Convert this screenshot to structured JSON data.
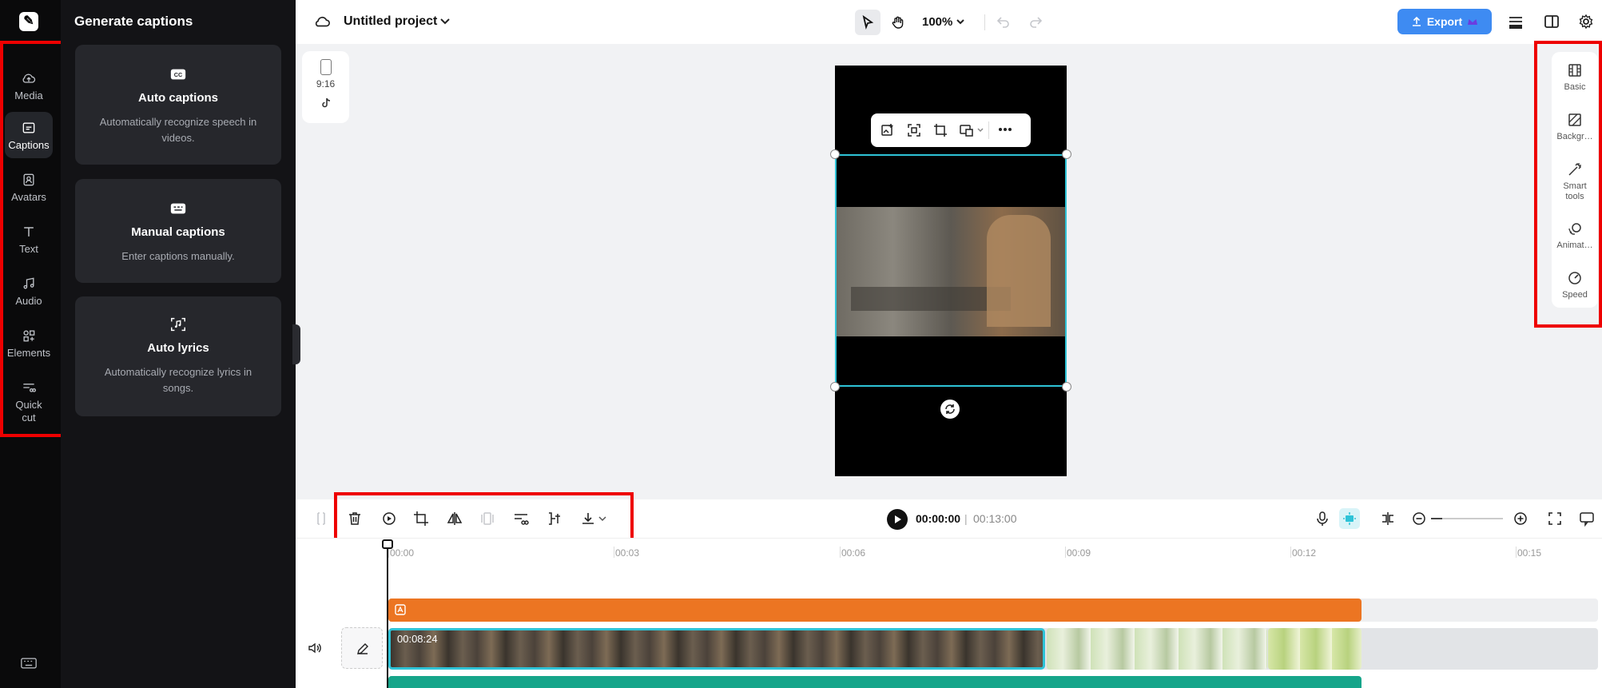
{
  "rail": {
    "items": [
      {
        "label": "Media",
        "icon": "cloud-upload-icon"
      },
      {
        "label": "Captions",
        "icon": "captions-icon"
      },
      {
        "label": "Avatars",
        "icon": "avatar-icon"
      },
      {
        "label": "Text",
        "icon": "text-icon"
      },
      {
        "label": "Audio",
        "icon": "music-note-icon"
      },
      {
        "label": "Elements",
        "icon": "elements-icon"
      },
      {
        "label": "Quick cut",
        "icon": "scissors-icon"
      }
    ],
    "active": "Captions"
  },
  "panel": {
    "title": "Generate captions",
    "cards": [
      {
        "title": "Auto captions",
        "desc": "Automatically recognize speech in videos.",
        "icon": "cc-icon"
      },
      {
        "title": "Manual captions",
        "desc": "Enter captions manually.",
        "icon": "keyboard-icon"
      },
      {
        "title": "Auto lyrics",
        "desc": "Automatically recognize lyrics in songs.",
        "icon": "music-scan-icon"
      }
    ]
  },
  "topbar": {
    "project_title": "Untitled project",
    "zoom": "100%",
    "export_label": "Export"
  },
  "aspect": {
    "ratio": "9:16"
  },
  "right_panel": {
    "items": [
      {
        "label": "Basic"
      },
      {
        "label": "Backgr…"
      },
      {
        "label": "Smart tools"
      },
      {
        "label": "Animat…"
      },
      {
        "label": "Speed"
      }
    ]
  },
  "timeline": {
    "current_time": "00:00:00",
    "separator": "|",
    "total_time": "00:13:00",
    "ticks": [
      "00:00",
      "00:03",
      "00:06",
      "00:09",
      "00:12",
      "00:15"
    ],
    "clip1_label": "00:08:24"
  },
  "colors": {
    "accent": "#3e8bf2",
    "selection": "#2ec3d7",
    "text_track": "#ec7522",
    "audio_track": "#16a58a",
    "annotation": "#ee0000"
  }
}
